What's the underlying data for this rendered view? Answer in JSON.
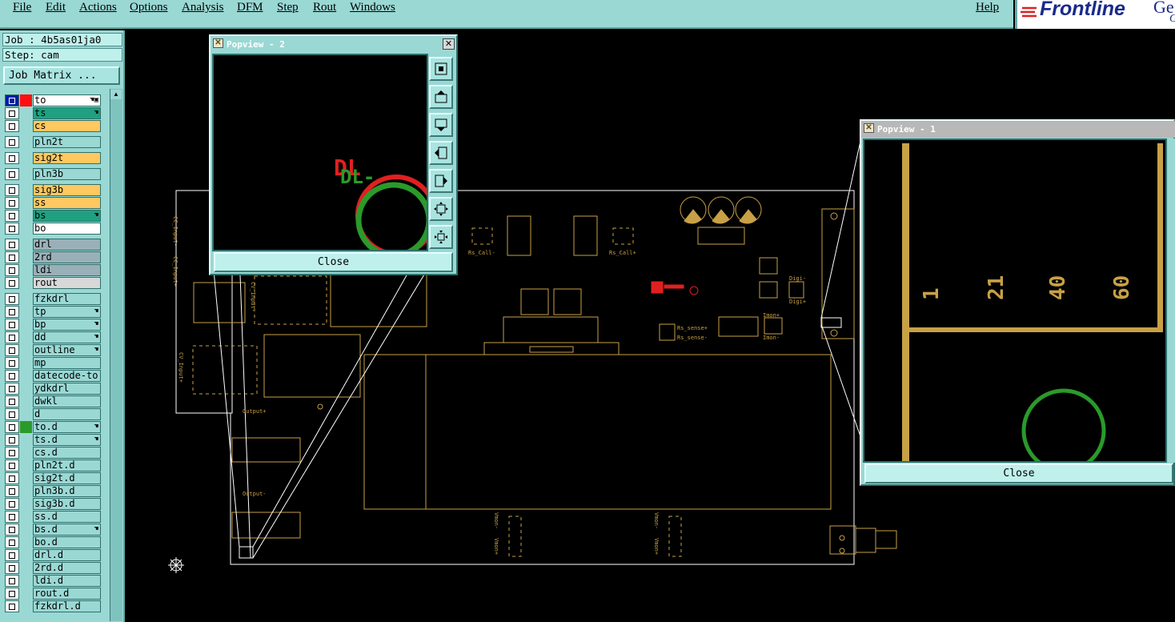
{
  "menu": {
    "items": [
      {
        "label": "File"
      },
      {
        "label": "Edit"
      },
      {
        "label": "Actions"
      },
      {
        "label": "Options"
      },
      {
        "label": "Analysis"
      },
      {
        "label": "DFM"
      },
      {
        "label": "Step"
      },
      {
        "label": "Rout"
      },
      {
        "label": "Windows"
      }
    ],
    "help": "Help"
  },
  "logo": {
    "text": "Frontline",
    "suffix": "Ge",
    "suffix2": "G"
  },
  "job": {
    "label": "Job : 4b5as01ja0",
    "step": "Step: cam",
    "matrix_button": "Job Matrix ..."
  },
  "layers": [
    {
      "name": "to",
      "color": "#ffffff",
      "checked_blue": true,
      "mark": "#ff1010",
      "hand": "☚▣"
    },
    {
      "name": "ts",
      "color": "#20a080",
      "mark": "",
      "hand": "☚"
    },
    {
      "name": "cs",
      "color": "#ffc860",
      "mark": "",
      "hand": ""
    },
    {
      "name": "pln2t",
      "color": "#9ad8d4",
      "mark": "",
      "hand": ""
    },
    {
      "name": "sig2t",
      "color": "#ffc860",
      "mark": "",
      "hand": ""
    },
    {
      "name": "pln3b",
      "color": "#9ad8d4",
      "mark": "",
      "hand": ""
    },
    {
      "name": "sig3b",
      "color": "#ffc860",
      "mark": "",
      "hand": ""
    },
    {
      "name": "ss",
      "color": "#ffc860",
      "mark": "",
      "hand": ""
    },
    {
      "name": "bs",
      "color": "#20a080",
      "mark": "",
      "hand": "☚"
    },
    {
      "name": "bo",
      "color": "#ffffff",
      "mark": "",
      "hand": ""
    },
    {
      "name": "drl",
      "color": "#9ab0b8",
      "mark": "",
      "hand": ""
    },
    {
      "name": "2rd",
      "color": "#9ab0b8",
      "mark": "",
      "hand": ""
    },
    {
      "name": "ldi",
      "color": "#9ab0b8",
      "mark": "",
      "hand": ""
    },
    {
      "name": "rout",
      "color": "#d8d8d8",
      "mark": "",
      "hand": ""
    },
    {
      "name": "fzkdrl",
      "color": "#9ad8d4",
      "mark": "",
      "hand": ""
    },
    {
      "name": "tp",
      "color": "#9ad8d4",
      "mark": "",
      "hand": "☚"
    },
    {
      "name": "bp",
      "color": "#9ad8d4",
      "mark": "",
      "hand": "☚"
    },
    {
      "name": "dd",
      "color": "#9ad8d4",
      "mark": "",
      "hand": "☚"
    },
    {
      "name": "outline",
      "color": "#9ad8d4",
      "mark": "",
      "hand": "☚"
    },
    {
      "name": "mp",
      "color": "#9ad8d4",
      "mark": "",
      "hand": ""
    },
    {
      "name": "datecode-to",
      "color": "#9ad8d4",
      "mark": "",
      "hand": ""
    },
    {
      "name": "ydkdrl",
      "color": "#9ad8d4",
      "mark": "",
      "hand": ""
    },
    {
      "name": "dwkl",
      "color": "#9ad8d4",
      "mark": "",
      "hand": ""
    },
    {
      "name": "d",
      "color": "#9ad8d4",
      "mark": "",
      "hand": ""
    },
    {
      "name": "to.d",
      "color": "#9ad8d4",
      "mark": "#2a9a2a",
      "hand": "☚"
    },
    {
      "name": "ts.d",
      "color": "#9ad8d4",
      "mark": "",
      "hand": "☚"
    },
    {
      "name": "cs.d",
      "color": "#9ad8d4",
      "mark": "",
      "hand": ""
    },
    {
      "name": "pln2t.d",
      "color": "#9ad8d4",
      "mark": "",
      "hand": ""
    },
    {
      "name": "sig2t.d",
      "color": "#9ad8d4",
      "mark": "",
      "hand": ""
    },
    {
      "name": "pln3b.d",
      "color": "#9ad8d4",
      "mark": "",
      "hand": ""
    },
    {
      "name": "sig3b.d",
      "color": "#9ad8d4",
      "mark": "",
      "hand": ""
    },
    {
      "name": "ss.d",
      "color": "#9ad8d4",
      "mark": "",
      "hand": ""
    },
    {
      "name": "bs.d",
      "color": "#9ad8d4",
      "mark": "",
      "hand": "☚"
    },
    {
      "name": "bo.d",
      "color": "#9ad8d4",
      "mark": "",
      "hand": ""
    },
    {
      "name": "drl.d",
      "color": "#9ad8d4",
      "mark": "",
      "hand": ""
    },
    {
      "name": "2rd.d",
      "color": "#9ad8d4",
      "mark": "",
      "hand": ""
    },
    {
      "name": "ldi.d",
      "color": "#9ad8d4",
      "mark": "",
      "hand": ""
    },
    {
      "name": "rout.d",
      "color": "#9ad8d4",
      "mark": "",
      "hand": ""
    },
    {
      "name": "fzkdrl.d",
      "color": "#9ad8d4",
      "mark": "",
      "hand": ""
    }
  ],
  "popview2": {
    "title": "Popview - 2",
    "close_label": "Close",
    "tools": [
      "zoom-home-icon",
      "pan-up-icon",
      "pan-down-icon",
      "pan-left-icon",
      "pan-right-icon",
      "zoom-in-icon",
      "zoom-out-icon"
    ]
  },
  "popview1": {
    "title": "Popview - 1",
    "close_label": "Close",
    "scale_numbers": [
      "1",
      "21",
      "40",
      "60"
    ]
  },
  "pcb": {
    "labels": [
      "CC_Input-",
      "CC_Input+",
      "CV_Input-",
      "CV_Input+",
      "Output+",
      "Output-",
      "Rs_Call-",
      "Rs_Call+",
      "Digi-",
      "Digi+",
      "Rs_sense+",
      "Rs_sense-",
      "Imon+",
      "Imon-",
      "Vmon-",
      "Vmon+"
    ],
    "pv2_text": "DL-"
  },
  "colors": {
    "panel": "#9ad8d4",
    "trace": "#c8a046",
    "pad_red": "#e02020",
    "pad_green": "#2a9a2a",
    "white_outline": "#ffffff"
  }
}
